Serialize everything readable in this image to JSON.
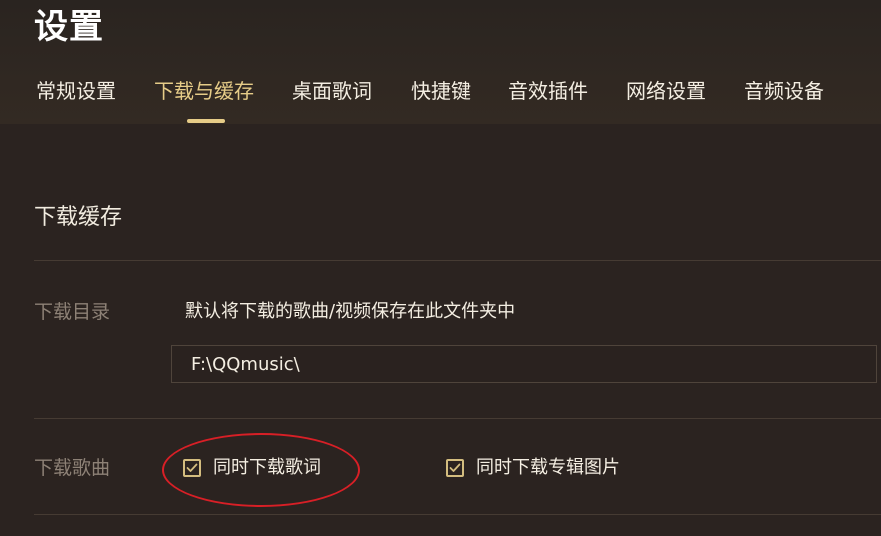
{
  "page": {
    "title": "设置"
  },
  "tabs": [
    {
      "label": "常规设置",
      "active": false
    },
    {
      "label": "下载与缓存",
      "active": true
    },
    {
      "label": "桌面歌词",
      "active": false
    },
    {
      "label": "快捷键",
      "active": false
    },
    {
      "label": "音效插件",
      "active": false
    },
    {
      "label": "网络设置",
      "active": false
    },
    {
      "label": "音频设备",
      "active": false
    }
  ],
  "section": {
    "title": "下载缓存"
  },
  "download_dir": {
    "label": "下载目录",
    "description": "默认将下载的歌曲/视频保存在此文件夹中",
    "path_value": "F:\\QQmusic\\"
  },
  "download_songs": {
    "label": "下载歌曲",
    "options": [
      {
        "label": "同时下载歌词",
        "checked": true
      },
      {
        "label": "同时下载专辑图片",
        "checked": true
      }
    ]
  },
  "colors": {
    "background": "#2b2320",
    "accent": "#e6cc88",
    "annotation": "#d81f26"
  },
  "icons": {
    "checkbox_checked": "checkmark-icon"
  }
}
